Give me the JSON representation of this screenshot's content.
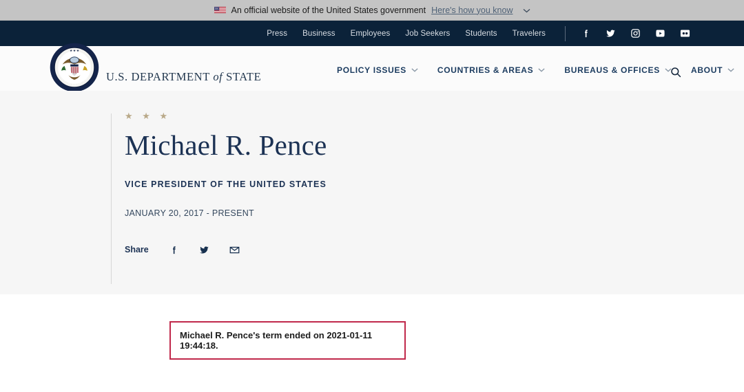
{
  "banner": {
    "flag_icon": "us-flag-icon",
    "text": "An official website of the United States government",
    "link_label": "Here's how you know",
    "chevron": "⌄"
  },
  "utility": {
    "links": [
      {
        "label": "Press"
      },
      {
        "label": "Business"
      },
      {
        "label": "Employees"
      },
      {
        "label": "Job Seekers"
      },
      {
        "label": "Students"
      },
      {
        "label": "Travelers"
      }
    ],
    "social": [
      {
        "name": "facebook-icon"
      },
      {
        "name": "twitter-icon"
      },
      {
        "name": "instagram-icon"
      },
      {
        "name": "youtube-icon"
      },
      {
        "name": "flickr-icon"
      }
    ]
  },
  "header": {
    "seal_icon": "us-department-of-state-seal",
    "brand_prefix": "U.S. DEPARTMENT ",
    "brand_italic": "of",
    "brand_suffix": " STATE",
    "nav": [
      {
        "label": "POLICY ISSUES"
      },
      {
        "label": "COUNTRIES & AREAS"
      },
      {
        "label": "BUREAUS & OFFICES"
      },
      {
        "label": "ABOUT"
      }
    ],
    "search_icon": "search-icon"
  },
  "hero": {
    "stars": "★ ★ ★",
    "name": "Michael R. Pence",
    "title": "VICE PRESIDENT OF THE UNITED STATES",
    "dates": "JANUARY 20, 2017 - PRESENT",
    "share_label": "Share",
    "share_icons": [
      {
        "name": "facebook-icon"
      },
      {
        "name": "twitter-icon"
      },
      {
        "name": "email-icon"
      }
    ]
  },
  "notice": {
    "text": "Michael R. Pence's term ended on 2021-01-11 19:44:18.",
    "border_color": "#c0284a"
  },
  "colors": {
    "banner_bg": "#c4c4c4",
    "utility_bg": "#0b2239",
    "hero_bg": "#f6f6f6",
    "navy": "#1c3254",
    "star_gold": "#b9a989"
  }
}
